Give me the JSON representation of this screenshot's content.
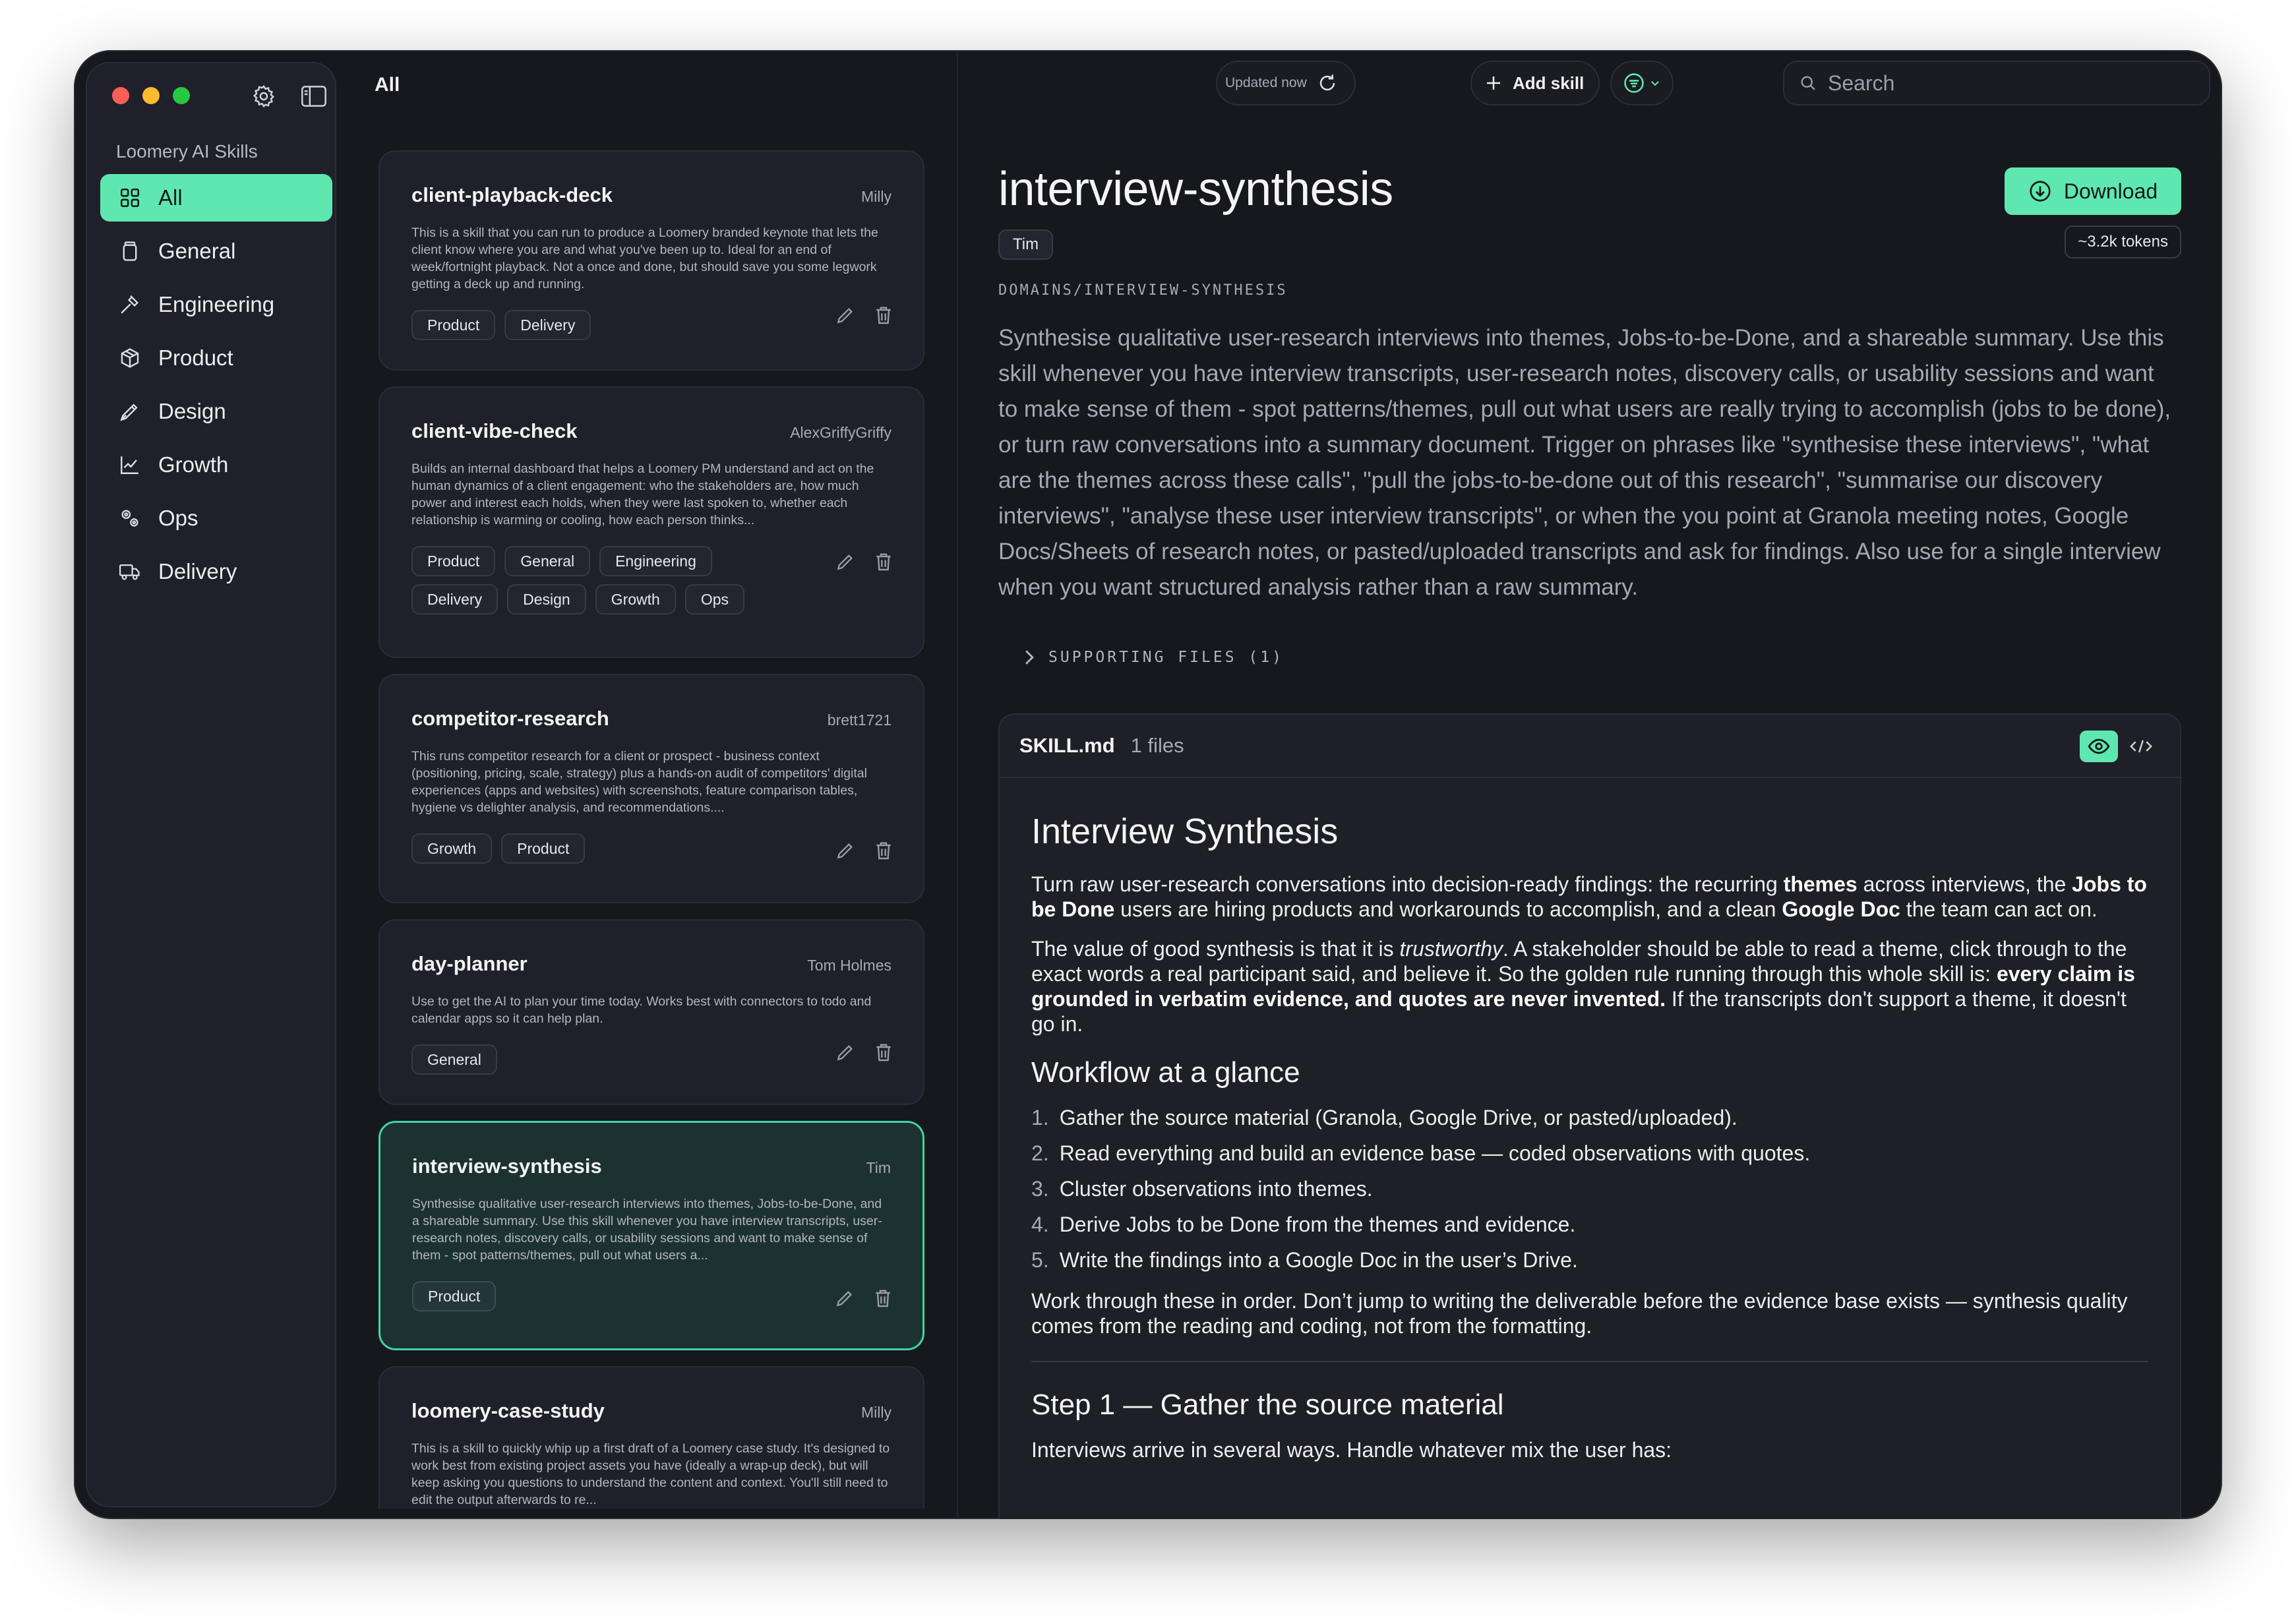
{
  "sidebar": {
    "title": "Loomery AI Skills",
    "items": [
      {
        "label": "All",
        "icon": "grid-icon",
        "active": true
      },
      {
        "label": "General",
        "icon": "jar-icon"
      },
      {
        "label": "Engineering",
        "icon": "hammer-icon"
      },
      {
        "label": "Product",
        "icon": "box-icon"
      },
      {
        "label": "Design",
        "icon": "pen-nib-icon"
      },
      {
        "label": "Growth",
        "icon": "chart-line-icon"
      },
      {
        "label": "Ops",
        "icon": "gears-icon"
      },
      {
        "label": "Delivery",
        "icon": "truck-icon"
      }
    ]
  },
  "list": {
    "header": "All",
    "cards": [
      {
        "title": "client-playback-deck",
        "author": "Milly",
        "desc": "This is a skill that you can run to produce a Loomery branded keynote that lets the client know where you are and what you've been up to. Ideal for an end of week/fortnight playback. Not a once and done, but should save you some legwork getting a deck up and running.",
        "tags": [
          "Product",
          "Delivery"
        ]
      },
      {
        "title": "client-vibe-check",
        "author": "AlexGriffyGriffy",
        "desc": "Builds an internal dashboard that helps a Loomery PM understand and act on the human dynamics of a client engagement: who the stakeholders are, how much power and interest each holds, when they were last spoken to, whether each relationship is warming or cooling, how each person thinks...",
        "tags": [
          "Product",
          "General",
          "Engineering",
          "Delivery",
          "Design",
          "Growth",
          "Ops"
        ]
      },
      {
        "title": "competitor-research",
        "author": "brett1721",
        "desc": "This runs competitor research for a client or prospect - business context (positioning, pricing, scale, strategy) plus a hands-on audit of competitors' digital experiences (apps and websites) with screenshots, feature comparison tables, hygiene vs delighter analysis, and recommendations....",
        "tags": [
          "Growth",
          "Product"
        ]
      },
      {
        "title": "day-planner",
        "author": "Tom Holmes",
        "desc": "Use to get the AI to plan your time today. Works best with connectors to todo and calendar apps so it can help plan.",
        "tags": [
          "General"
        ]
      },
      {
        "title": "interview-synthesis",
        "author": "Tim",
        "desc": "Synthesise qualitative user-research interviews into themes, Jobs-to-be-Done, and a shareable summary. Use this skill whenever you have interview transcripts, user-research notes, discovery calls, or usability sessions and want to make sense of them - spot patterns/themes, pull out what users a...",
        "tags": [
          "Product"
        ],
        "selected": true
      },
      {
        "title": "loomery-case-study",
        "author": "Milly",
        "desc": "This is a skill to quickly whip up a first draft of a Loomery case study. It's designed to work best from existing project assets you have (ideally a wrap-up deck), but will keep asking you questions to understand the content and context. You'll still need to edit the output afterwards to re...",
        "tags": []
      }
    ]
  },
  "toolbar": {
    "updated": "Updated now",
    "add_skill": "Add skill",
    "search_placeholder": "Search"
  },
  "detail": {
    "title": "interview-synthesis",
    "author": "Tim",
    "download": "Download",
    "tokens": "~3.2k tokens",
    "path": "DOMAINS/INTERVIEW-SYNTHESIS",
    "description": "Synthesise qualitative user-research interviews into themes, Jobs-to-be-Done, and a shareable summary. Use this skill whenever you have interview transcripts, user-research notes, discovery calls, or usability sessions and want to make sense of them - spot patterns/themes, pull out what users are really trying to accomplish (jobs to be done), or turn raw conversations into a summary document. Trigger on phrases like \"synthesise these interviews\", \"what are the themes across these calls\", \"pull the jobs-to-be-done out of this research\", \"summarise our discovery interviews\", \"analyse these user interview transcripts\", or when the you point at Granola meeting notes, Google Docs/Sheets of research notes, or pasted/uploaded transcripts and ask for findings. Also use for a single interview when you want structured analysis rather than a raw summary.",
    "supporting": "SUPPORTING FILES (1)",
    "file_name": "SKILL.md",
    "file_count": "1 files",
    "doc": {
      "h1": "Interview Synthesis",
      "p1_a": "Turn raw user-research conversations into decision-ready findings: the recurring ",
      "p1_b": "themes",
      "p1_c": " across interviews, the ",
      "p1_d": "Jobs to be Done",
      "p1_e": " users are hiring products and workarounds to accomplish, and a clean ",
      "p1_f": "Google Doc",
      "p1_g": " the team can act on.",
      "p2_a": "The value of good synthesis is that it is ",
      "p2_b": "trustworthy",
      "p2_c": ". A stakeholder should be able to read a theme, click through to the exact words a real participant said, and believe it. So the golden rule running through this whole skill is: ",
      "p2_d": "every claim is grounded in verbatim evidence, and quotes are never invented.",
      "p2_e": " If the transcripts don't support a theme, it doesn't go in.",
      "h2a": "Workflow at a glance",
      "steps": [
        "Gather the source material (Granola, Google Drive, or pasted/uploaded).",
        "Read everything and build an evidence base — coded observations with quotes.",
        "Cluster observations into themes.",
        "Derive Jobs to be Done from the themes and evidence.",
        "Write the findings into a Google Doc in the user’s Drive."
      ],
      "p3": "Work through these in order. Don’t jump to writing the deliverable before the evidence base exists — synthesis quality comes from the reading and coding, not from the formatting.",
      "h2b": "Step 1 — Gather the source material",
      "p4": "Interviews arrive in several ways. Handle whatever mix the user has:"
    }
  },
  "colors": {
    "accent": "#5ee8b0",
    "bg": "#17171e",
    "panel": "#20202a"
  }
}
